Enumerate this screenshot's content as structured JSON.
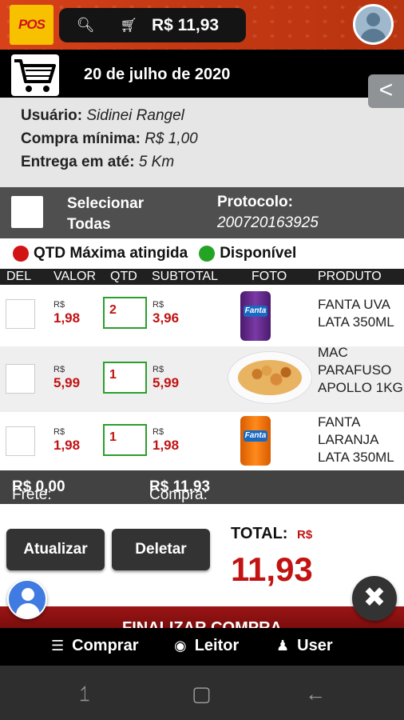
{
  "header": {
    "logo_text": "POS",
    "cart_total": "R$ 11,93",
    "icons": [
      "search-icon",
      "cart-icon",
      "avatar-icon"
    ]
  },
  "datebar": {
    "date": "20 de julho de 2020",
    "back": "<"
  },
  "info": {
    "user_label": "Usuário:",
    "user_value": "Sidinei Rangel",
    "min_label": "Compra mínima:",
    "min_value": "R$ 1,00",
    "delivery_label": "Entrega em até:",
    "delivery_value": "5 Km"
  },
  "selection": {
    "select_all": "Selecionar Todas",
    "protocol_label": "Protocolo:",
    "protocol_value": "200720163925"
  },
  "legend": {
    "max_reached": "QTD Máxima atingida",
    "max_color": "#d11313",
    "available": "Disponível",
    "available_color": "#25a325"
  },
  "table": {
    "headers": [
      "DEL",
      "VALOR",
      "QTD",
      "SUBTOTAL",
      "FOTO",
      "PRODUTO"
    ],
    "currency": "R$",
    "rows": [
      {
        "value": "1,98",
        "qty": "2",
        "subtotal": "3,96",
        "name": "FANTA UVA LATA 350ML",
        "photo": "grape-soda-can"
      },
      {
        "value": "5,99",
        "qty": "1",
        "subtotal": "5,99",
        "name": "MAC PARAFUSO APOLLO 1KG",
        "photo": "pasta-plate"
      },
      {
        "value": "1,98",
        "qty": "1",
        "subtotal": "1,98",
        "name": "FANTA LARANJA LATA 350ML",
        "photo": "orange-soda-can"
      }
    ]
  },
  "totals": {
    "freight_label": "Frete:",
    "freight_value": "R$ 0,00",
    "purchase_label": "Compra:",
    "purchase_value": "R$ 11,93",
    "total_label": "TOTAL:",
    "total_currency": "R$",
    "total_value": "11,93"
  },
  "actions": {
    "update": "Atualizar",
    "delete": "Deletar",
    "finalize": "FINALIZAR COMPRA"
  },
  "nav": {
    "buy": "Comprar",
    "reader": "Leitor",
    "user": "User"
  },
  "colors": {
    "accent_red": "#c21212",
    "header_orange": "#c53914",
    "qty_border": "#2e9e2e"
  }
}
